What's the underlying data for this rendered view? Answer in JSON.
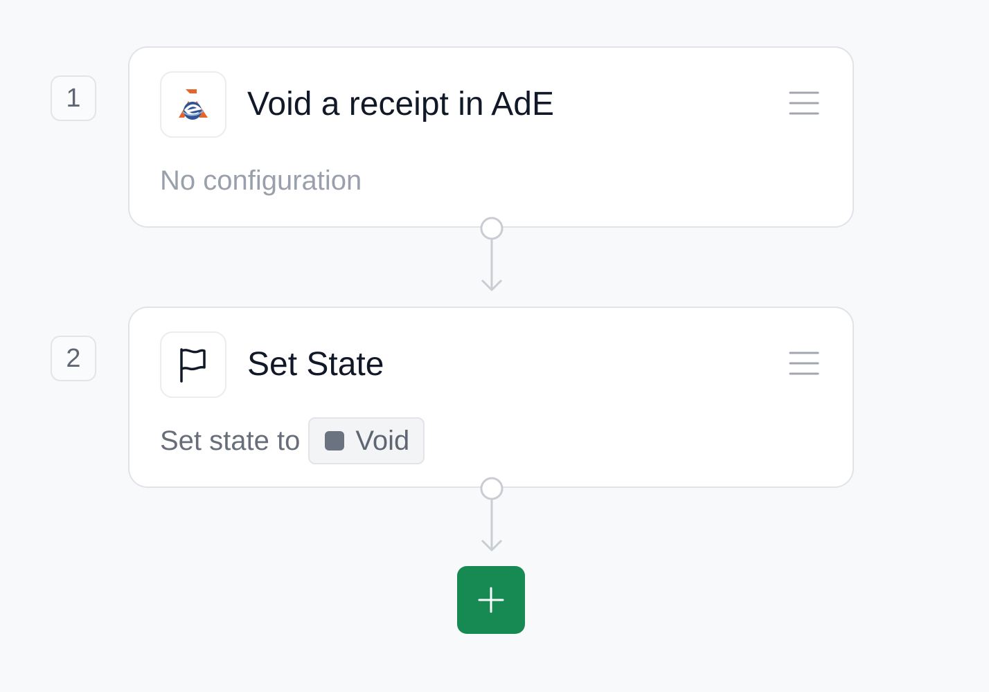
{
  "steps": [
    {
      "number": "1",
      "title": "Void a receipt in AdE",
      "description": "No configuration",
      "icon": "ade-logo-icon"
    },
    {
      "number": "2",
      "title": "Set State",
      "description_prefix": "Set state to",
      "state": {
        "label": "Void",
        "color": "#6b7280"
      },
      "icon": "flag-icon"
    }
  ],
  "add_step": {
    "icon": "plus-icon",
    "color": "#178a54"
  }
}
